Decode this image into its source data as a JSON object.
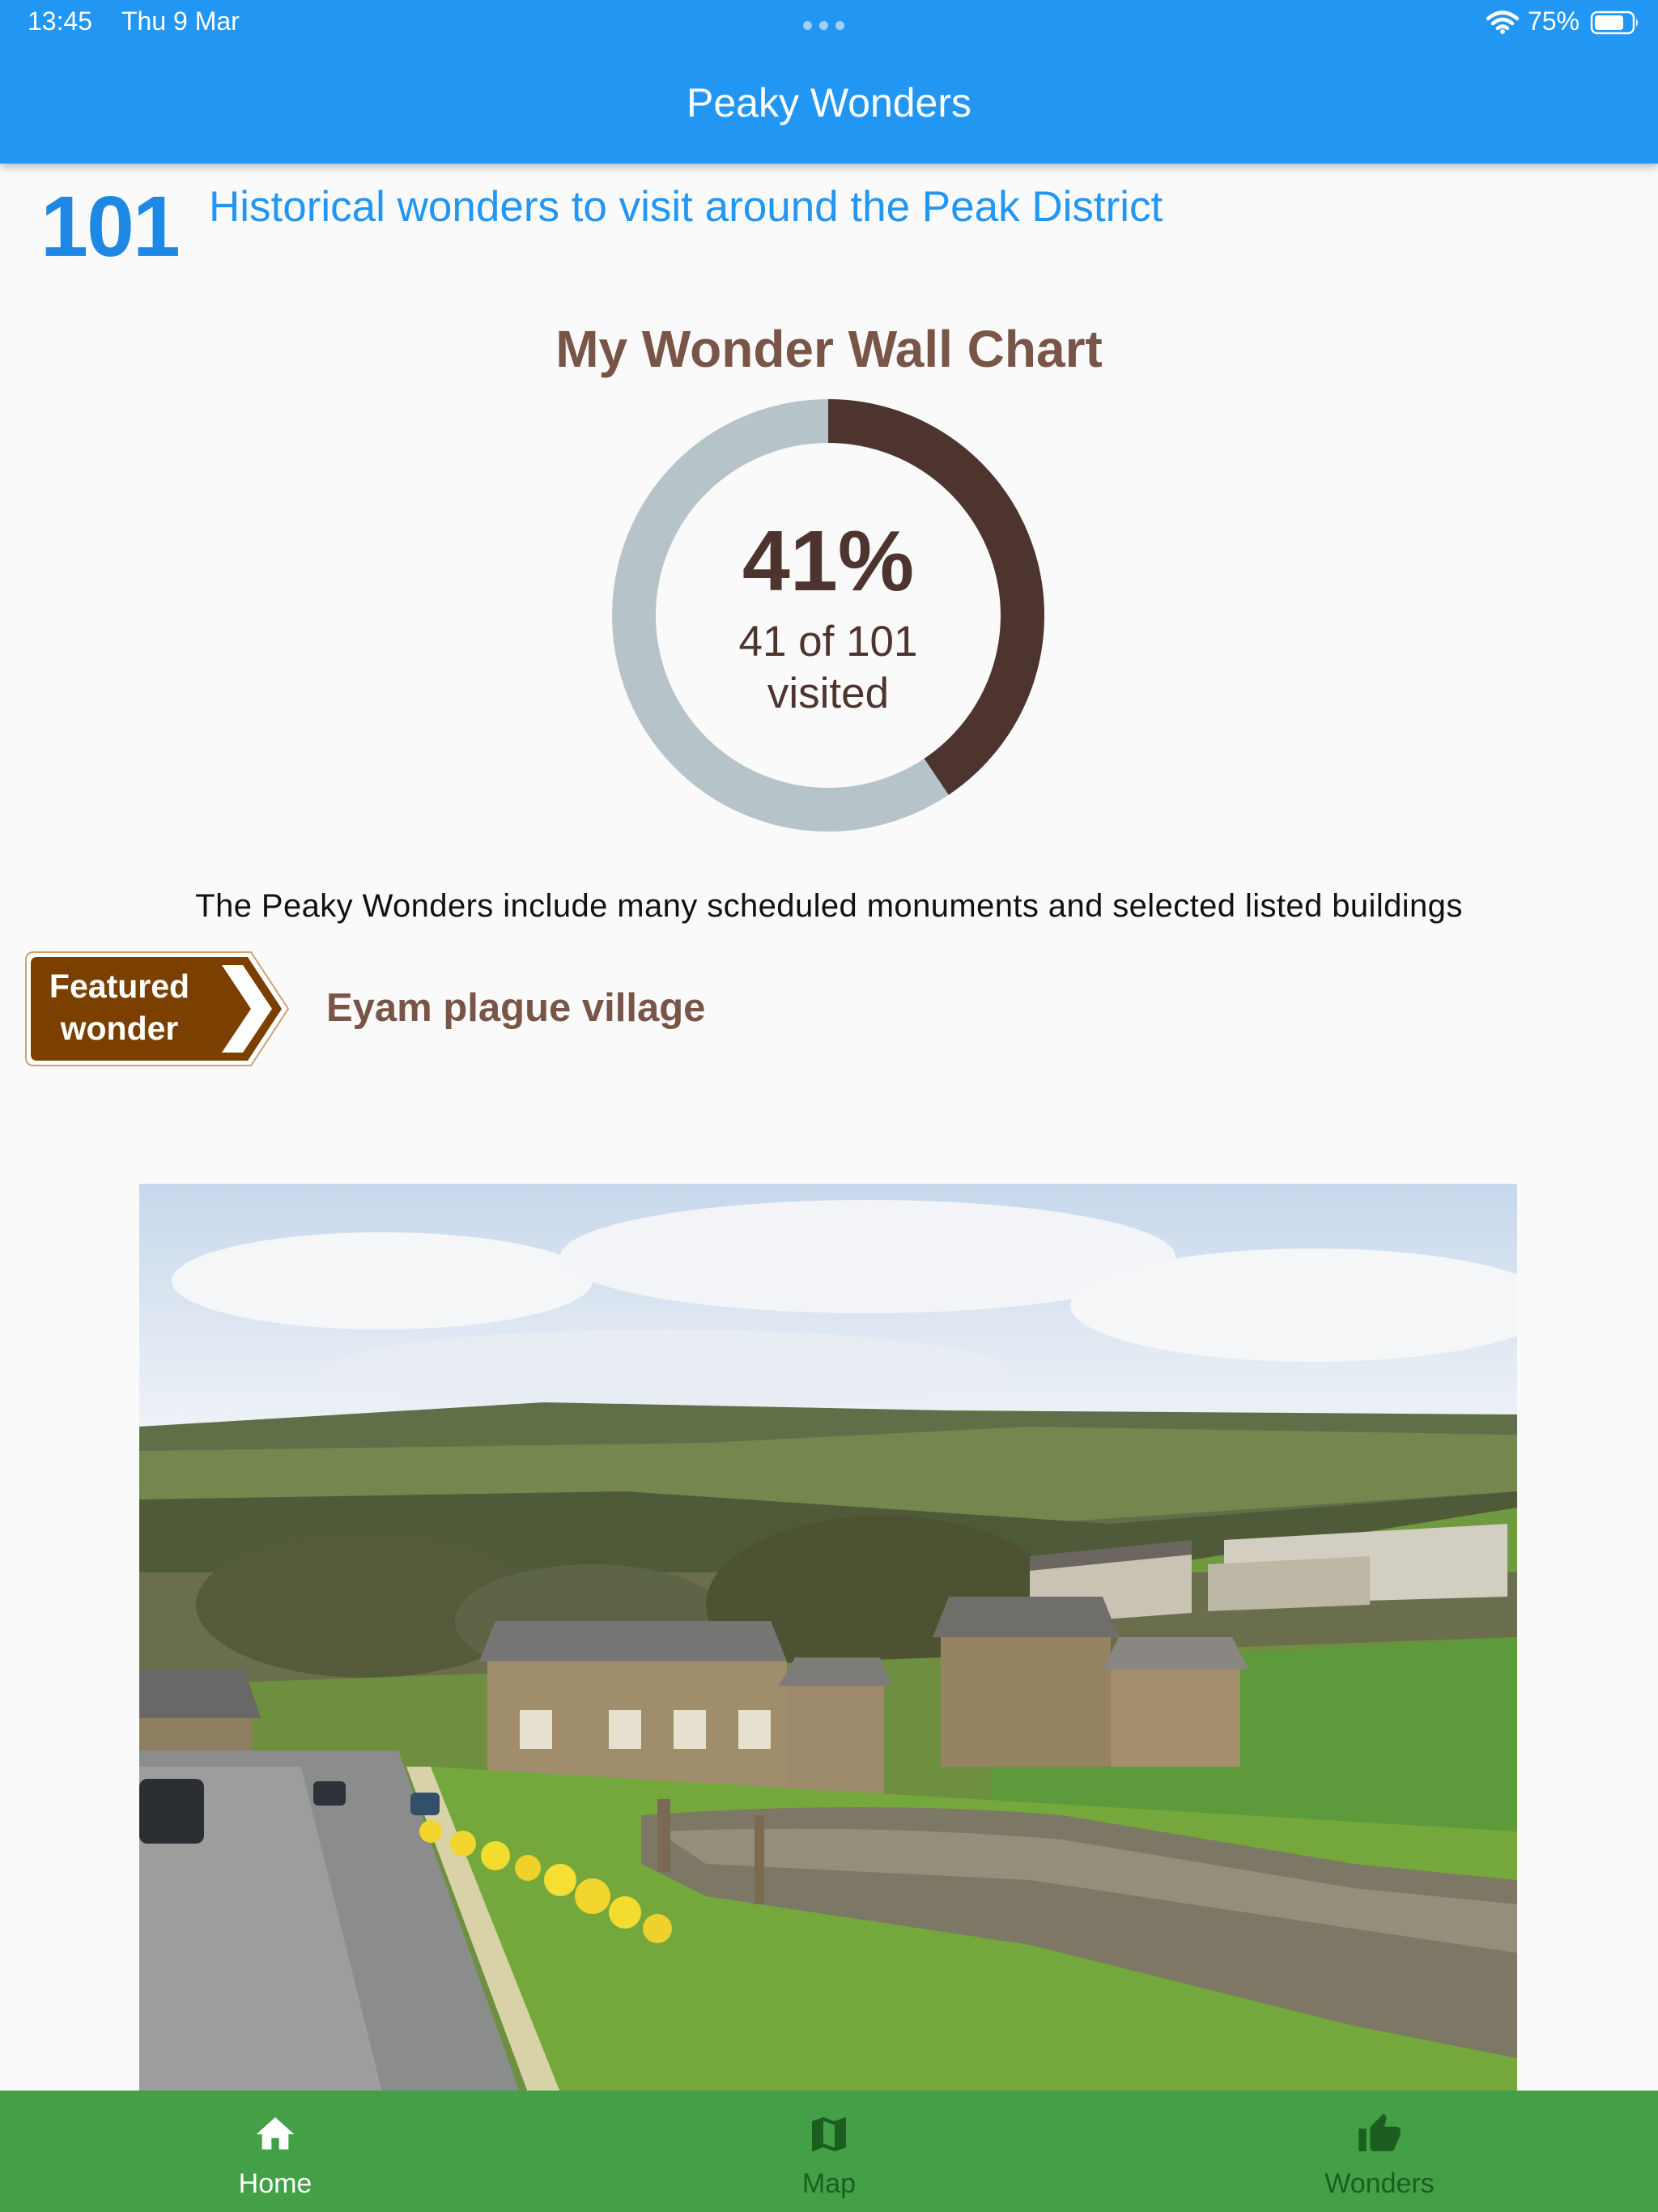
{
  "status_bar": {
    "time": "13:45",
    "date": "Thu 9 Mar",
    "battery": "75%",
    "icons": [
      "wifi-icon",
      "battery-icon",
      "multitasking-dots-icon"
    ]
  },
  "app_bar": {
    "title": "Peaky Wonders",
    "color": "#2196f3"
  },
  "intro": {
    "count": "101",
    "text": "Historical wonders to visit around the Peak District"
  },
  "wall_chart": {
    "title": "My Wonder Wall Chart",
    "percent_label": "41%",
    "visited_label": "41 of 101",
    "visited_suffix": "visited",
    "colors": {
      "progress": "#4e342e",
      "track": "#b6c4c9"
    }
  },
  "chart_data": {
    "type": "pie",
    "title": "My Wonder Wall Chart",
    "slices": [
      {
        "label": "visited",
        "value": 41
      },
      {
        "label": "not visited",
        "value": 60
      }
    ],
    "total": 101,
    "percent": 41
  },
  "description": "The Peaky Wonders include many scheduled monuments and selected listed buildings",
  "featured": {
    "badge_line1": "Featured",
    "badge_line2": "wonder",
    "name": "Eyam plague village",
    "badge_color": "#7b3f00",
    "image_subject": "Eyam village landscape photo"
  },
  "bottom_nav": {
    "color": "#43a047",
    "items": [
      {
        "label": "Home",
        "icon": "home-icon",
        "active": true
      },
      {
        "label": "Map",
        "icon": "map-icon",
        "active": false
      },
      {
        "label": "Wonders",
        "icon": "thumb-up-icon",
        "active": false
      }
    ]
  }
}
